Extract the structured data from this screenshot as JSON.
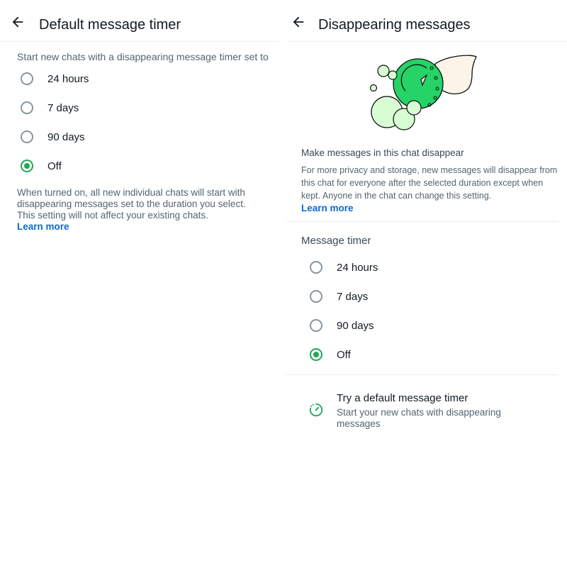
{
  "left_screen": {
    "title": "Default message timer",
    "section_hint": "Start new chats with a disappearing message timer set to",
    "options": [
      {
        "label": "24 hours",
        "selected": false
      },
      {
        "label": "7 days",
        "selected": false
      },
      {
        "label": "90 days",
        "selected": false
      },
      {
        "label": "Off",
        "selected": true
      }
    ],
    "footnote": "When turned on, all new individual chats will start with disappearing messages set to the duration you select. This setting will not affect your existing chats.",
    "learn_more": "Learn more"
  },
  "right_screen": {
    "title": "Disappearing messages",
    "illustration_icon": "disappearing-timer-illustration",
    "about_title": "Make messages in this chat disappear",
    "about_body": "For more privacy and storage, new messages will disappear from this chat for everyone after the selected duration except when kept. Anyone in the chat can change this setting.",
    "learn_more": "Learn more",
    "timer_header": "Message timer",
    "options": [
      {
        "label": "24 hours",
        "selected": false
      },
      {
        "label": "7 days",
        "selected": false
      },
      {
        "label": "90 days",
        "selected": false
      },
      {
        "label": "Off",
        "selected": true
      }
    ],
    "promo": {
      "icon": "timer-icon",
      "title": "Try a default message timer",
      "subtitle": "Start your new chats with disappearing messages"
    }
  },
  "colors": {
    "accent_green": "#1fa855",
    "link_blue": "#0b6bcb",
    "illustration_light_green": "#d9fdd3",
    "illustration_cream": "#fdf4e8"
  },
  "icons": {
    "back": "arrow-left-icon",
    "radio_checked": "radio-checked-icon",
    "radio_unchecked": "radio-unchecked-icon"
  }
}
